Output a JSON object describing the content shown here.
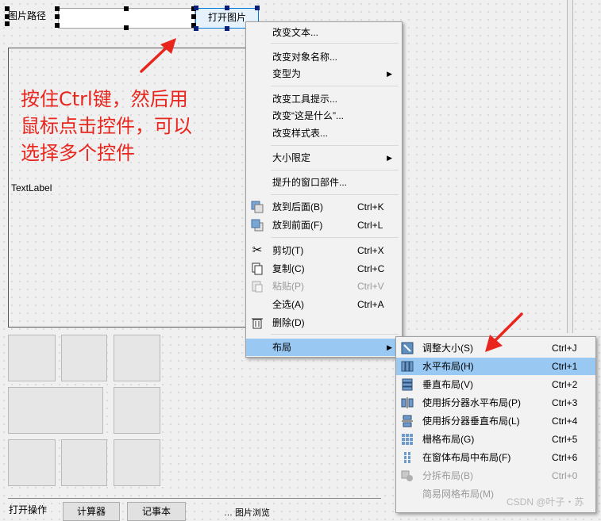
{
  "form": {
    "path_label": "图片路径",
    "open_button": "打开图片",
    "text_label": "TextLabel",
    "bottom_label": "打开操作",
    "bottom_btn1": "计算器",
    "bottom_btn2": "记事本",
    "bottom_more": "… 图片浏览"
  },
  "annotations": {
    "main": [
      "按住Ctrl键，然后用",
      "鼠标点击控件，可以",
      "选择多个控件"
    ],
    "arrow_color": "#e8261e"
  },
  "context_menu": {
    "items": [
      {
        "label": "改变文本..."
      },
      {
        "label": "改变对象名称..."
      },
      {
        "label": "变型为",
        "submenu": true
      },
      {
        "label": "改变工具提示..."
      },
      {
        "label": "改变“这是什么”..."
      },
      {
        "label": "改变样式表..."
      },
      {
        "label": "大小限定",
        "submenu": true
      },
      {
        "label": "提升的窗口部件..."
      },
      {
        "label": "放到后面(B)",
        "shortcut": "Ctrl+K",
        "icon": "send-to-back-icon"
      },
      {
        "label": "放到前面(F)",
        "shortcut": "Ctrl+L",
        "icon": "bring-to-front-icon"
      },
      {
        "label": "剪切(T)",
        "shortcut": "Ctrl+X",
        "icon": "scissors-icon"
      },
      {
        "label": "复制(C)",
        "shortcut": "Ctrl+C",
        "icon": "copy-icon"
      },
      {
        "label": "粘贴(P)",
        "shortcut": "Ctrl+V",
        "icon": "paste-icon",
        "disabled": true
      },
      {
        "label": "全选(A)",
        "shortcut": "Ctrl+A"
      },
      {
        "label": "删除(D)",
        "icon": "trash-icon"
      },
      {
        "label": "布局",
        "submenu": true,
        "highlighted": true
      }
    ]
  },
  "layout_submenu": {
    "items": [
      {
        "label": "调整大小(S)",
        "shortcut": "Ctrl+J",
        "icon": "adjust-size-icon"
      },
      {
        "label": "水平布局(H)",
        "shortcut": "Ctrl+1",
        "icon": "horizontal-layout-icon",
        "highlighted": true
      },
      {
        "label": "垂直布局(V)",
        "shortcut": "Ctrl+2",
        "icon": "vertical-layout-icon"
      },
      {
        "label": "使用拆分器水平布局(P)",
        "shortcut": "Ctrl+3",
        "icon": "horizontal-splitter-icon"
      },
      {
        "label": "使用拆分器垂直布局(L)",
        "shortcut": "Ctrl+4",
        "icon": "vertical-splitter-icon"
      },
      {
        "label": "栅格布局(G)",
        "shortcut": "Ctrl+5",
        "icon": "grid-layout-icon"
      },
      {
        "label": "在窗体布局中布局(F)",
        "shortcut": "Ctrl+6",
        "icon": "form-layout-icon"
      },
      {
        "label": "分拆布局(B)",
        "shortcut": "Ctrl+0",
        "icon": "break-layout-icon",
        "disabled": true
      },
      {
        "label": "简易网格布局(M)",
        "disabled": true
      }
    ]
  },
  "watermark": "CSDN @叶子・苏"
}
